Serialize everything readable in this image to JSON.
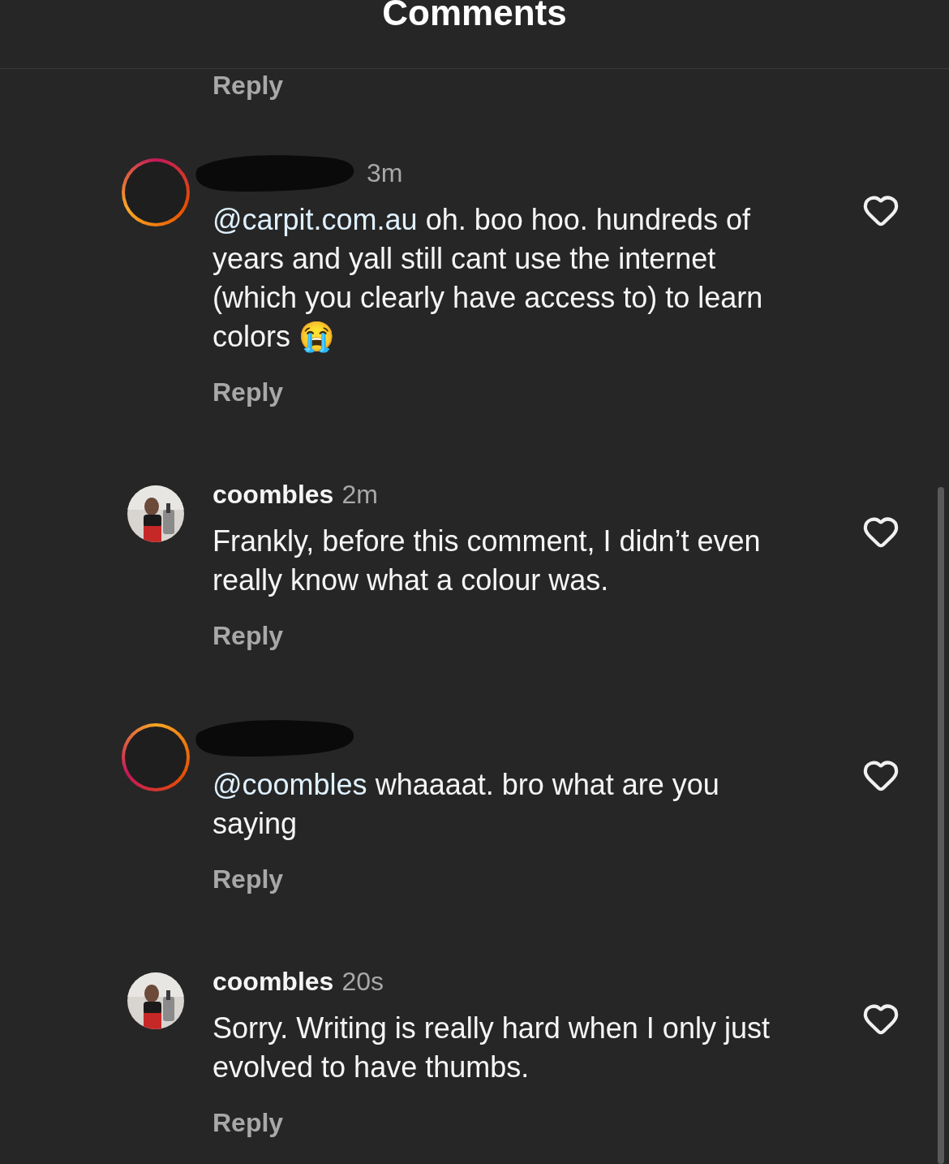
{
  "header": {
    "title": "Comments"
  },
  "top_reply": "Reply",
  "comments": [
    {
      "redacted": true,
      "story_ring": true,
      "time": "3m",
      "mention": "@carpit.com.au",
      "text": " oh. boo hoo. hundreds of years and yall still cant use the internet (which you clearly have access to) to learn colors 😭",
      "reply": "Reply",
      "liked": false
    },
    {
      "redacted": false,
      "story_ring": false,
      "username": "coombles",
      "time": "2m",
      "text": "Frankly, before this comment, I didn’t even really know what a colour was.",
      "reply": "Reply",
      "liked": false
    },
    {
      "redacted": true,
      "story_ring": true,
      "mention": "@coombles",
      "text": " whaaaat. bro what are you saying",
      "reply": "Reply",
      "liked": false
    },
    {
      "redacted": false,
      "story_ring": false,
      "username": "coombles",
      "time": "20s",
      "text": "Sorry. Writing is really hard when I only just evolved to have thumbs.",
      "reply": "Reply",
      "liked": false
    }
  ]
}
